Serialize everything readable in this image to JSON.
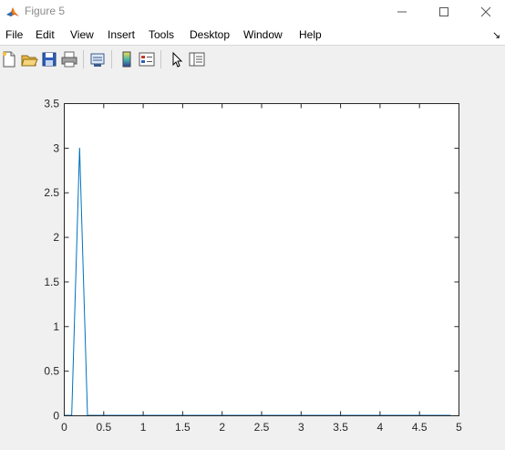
{
  "window": {
    "title": "Figure 5"
  },
  "menu": {
    "items": [
      "File",
      "Edit",
      "View",
      "Insert",
      "Tools",
      "Desktop",
      "Window",
      "Help"
    ]
  },
  "toolbar": {
    "buttons": [
      {
        "name": "new-figure-icon"
      },
      {
        "name": "open-file-icon"
      },
      {
        "name": "save-icon"
      },
      {
        "name": "print-icon"
      },
      {
        "name": "link-plot-icon"
      },
      {
        "name": "colorbar-icon"
      },
      {
        "name": "legend-icon"
      },
      {
        "name": "edit-plot-arrow-icon"
      },
      {
        "name": "property-inspector-icon"
      }
    ]
  },
  "chart_data": {
    "type": "line",
    "x": [
      0,
      0.1,
      0.2,
      0.3,
      0.4,
      0.5,
      0.6,
      0.7,
      0.8,
      0.9,
      1.0,
      1.1,
      1.2,
      1.3,
      1.4,
      1.5,
      1.6,
      1.7,
      1.8,
      1.9,
      2.0,
      2.1,
      2.2,
      2.3,
      2.4,
      2.5,
      2.6,
      2.7,
      2.8,
      2.9,
      3.0,
      3.1,
      3.2,
      3.3,
      3.4,
      3.5,
      3.6,
      3.7,
      3.8,
      3.9,
      4.0,
      4.1,
      4.2,
      4.3,
      4.4,
      4.5,
      4.6,
      4.7,
      4.8,
      4.9
    ],
    "series": [
      {
        "color": "#0072bd",
        "values": [
          0,
          0,
          3,
          0,
          0,
          0,
          0,
          0,
          0,
          0,
          0,
          0,
          0,
          0,
          0,
          0,
          0,
          0,
          0,
          0,
          0,
          0,
          0,
          0,
          0,
          0,
          0,
          0,
          0,
          0,
          0,
          0,
          0,
          0,
          0,
          0,
          0,
          0,
          0,
          0,
          0,
          0,
          0,
          0,
          0,
          0,
          0,
          0,
          0,
          0
        ]
      }
    ],
    "xlim": [
      0,
      5
    ],
    "ylim": [
      0,
      3.5
    ],
    "xticks": [
      "0",
      "0.5",
      "1",
      "1.5",
      "2",
      "2.5",
      "3",
      "3.5",
      "4",
      "4.5",
      "5"
    ],
    "yticks": [
      "0",
      "0.5",
      "1",
      "1.5",
      "2",
      "2.5",
      "3",
      "3.5"
    ],
    "grid": false,
    "title": "",
    "xlabel": "",
    "ylabel": ""
  }
}
